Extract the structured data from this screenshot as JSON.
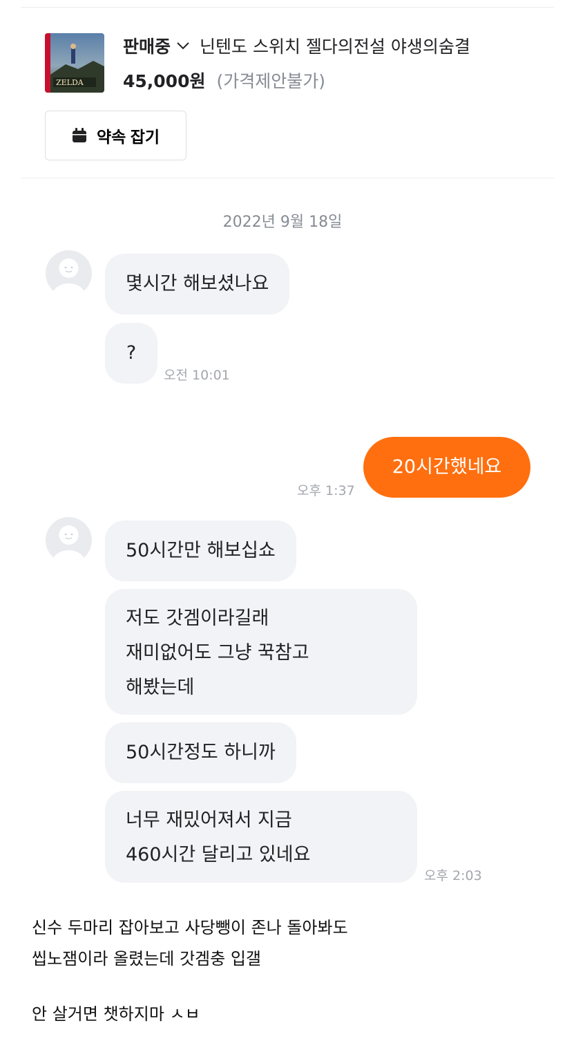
{
  "product": {
    "thumbnail_text": "ZELDA",
    "status": "판매중",
    "title": "닌텐도 스위치 젤다의전설 야생의숨결",
    "price": "45,000원",
    "price_note": "(가격제안불가)",
    "appointment_button": "약속 잡기"
  },
  "chat": {
    "date": "2022년 9월 18일",
    "messages": [
      {
        "text": "몇시간 해보셨나요"
      },
      {
        "text": "?",
        "time": "오전 10:01"
      },
      {
        "text": "20시간했네요",
        "time": "오후 1:37"
      },
      {
        "text": "50시간만 해보십쇼"
      },
      {
        "lines": [
          "저도 갓겜이라길래",
          "재미없어도 그냥 꾹참고",
          "해봤는데"
        ]
      },
      {
        "text": "50시간정도 하니까"
      },
      {
        "lines": [
          "너무 재밌어져서 지금",
          "460시간 달리고 있네요"
        ],
        "time": "오후 2:03"
      }
    ]
  },
  "caption": {
    "lines": [
      "신수 두마리 잡아보고 사당뺑이 존나 돌아봐도",
      "씹노잼이라 올렸는데 갓겜충 입갤",
      "안 살거면 챗하지마 ㅅㅂ"
    ]
  },
  "colors": {
    "accent": "#ff6f0f",
    "bubble": "#f2f3f6",
    "muted": "#868b94"
  },
  "icons": {
    "status_dropdown": "chevron-down-icon",
    "appointment": "calendar-icon",
    "avatar": "default-avatar-icon"
  }
}
